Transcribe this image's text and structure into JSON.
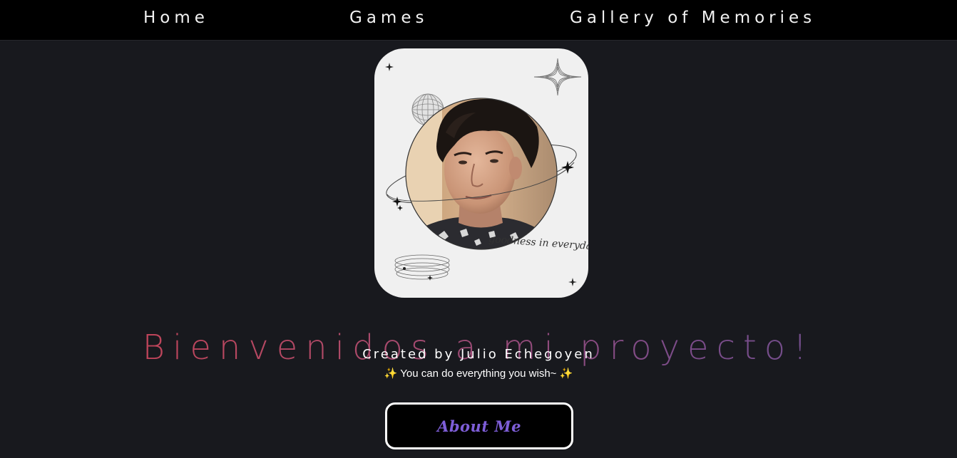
{
  "nav": {
    "home": "Home",
    "games": "Games",
    "gallery": "Gallery of Memories"
  },
  "profile": {
    "photo_caption": "goodness in everyday life"
  },
  "hero": {
    "title": "Bienvenidos a mi proyecto!",
    "credit": "Created by Julio Echegoyen",
    "tagline": "You can do everything you wish~",
    "sparkle": "✨"
  },
  "about_button": {
    "label": "About Me"
  },
  "colors": {
    "background": "#18191e",
    "navbar": "#000000",
    "title_gradient_start": "#c9404f",
    "title_gradient_end": "#6a5090",
    "button_text": "#7e5ed8"
  }
}
